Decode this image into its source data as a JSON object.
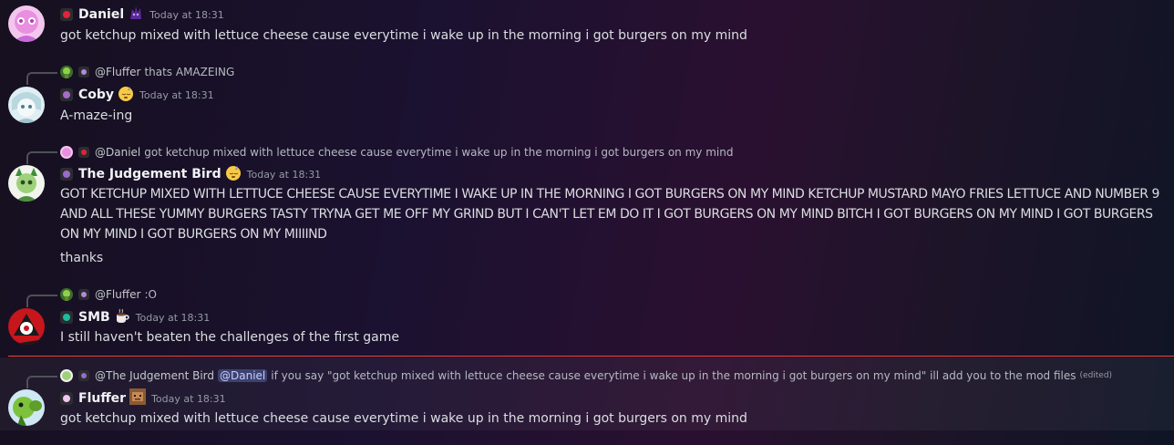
{
  "messages": [
    {
      "username": "Daniel",
      "role_color": "#e0243b",
      "timestamp": "Today at 18:31",
      "text": "got ketchup mixed with lettuce cheese cause everytime i wake up in the morning i got burgers on my mind"
    },
    {
      "reply_to": {
        "username": "@Fluffer",
        "text": "thats AMAZEING"
      },
      "username": "Coby",
      "role_color": "#a66cc8",
      "timestamp": "Today at 18:31",
      "text": "A-maze-ing"
    },
    {
      "reply_to": {
        "username": "@Daniel",
        "text": "got ketchup mixed with lettuce cheese cause everytime i wake up in the morning i got burgers on my mind"
      },
      "username": "The Judgement Bird",
      "role_color": "#9b6bc9",
      "timestamp": "Today at 18:31",
      "text": "GOT KETCHUP MIXED WITH LETTUCE CHEESE CAUSE EVERYTIME I WAKE UP IN THE MORNING I GOT BURGERS ON MY MIND KETCHUP MUSTARD MAYO FRIES LETTUCE AND NUMBER 9 AND ALL THESE YUMMY BURGERS TASTY TRYNA GET ME OFF MY GRIND BUT I CAN'T LET EM DO IT I GOT BURGERS ON MY MIND BITCH I GOT BURGERS ON MY MIND I GOT BURGERS ON MY MIND I GOT BURGERS ON MY MIIIIND",
      "followup": "thanks"
    },
    {
      "reply_to": {
        "username": "@Fluffer",
        "text": ":O"
      },
      "username": "SMB",
      "role_color": "#1abc9c",
      "timestamp": "Today at 18:31",
      "text": "I still haven't beaten the challenges of the first game"
    },
    {
      "reply_to": {
        "username": "@The Judgement Bird",
        "mention": "@Daniel",
        "text": "if you say \"got ketchup mixed with lettuce cheese cause everytime i wake up in the morning i got burgers on my mind\" ill add you to the mod files",
        "edited": "(edited)"
      },
      "username": "Fluffer",
      "role_color": "#f1c6f0",
      "timestamp": "Today at 18:31",
      "text": "got ketchup mixed with lettuce cheese cause everytime i wake up in the morning i got burgers on my mind"
    }
  ]
}
